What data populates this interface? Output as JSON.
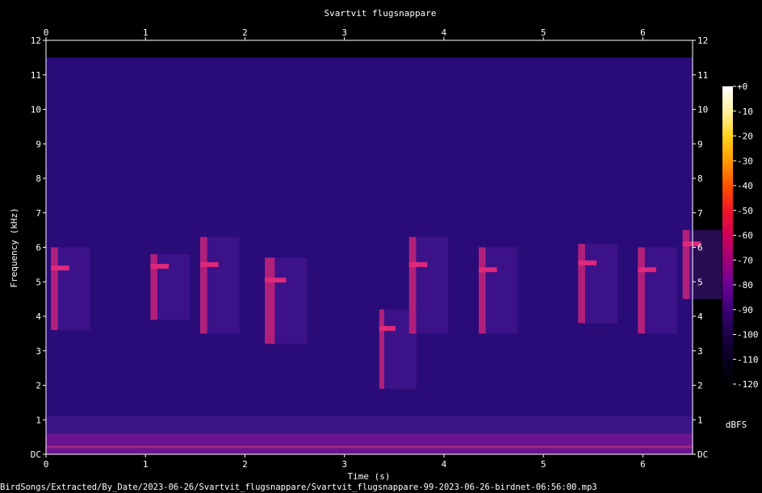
{
  "chart_data": {
    "type": "heatmap",
    "title": "Svartvit flugsnappare",
    "xlabel": "Time (s)",
    "ylabel": "Frequency (kHz)",
    "xlim": [
      0,
      6.5
    ],
    "ylim": [
      0,
      12
    ],
    "x_ticks": [
      0,
      1,
      2,
      3,
      4,
      5,
      6
    ],
    "y_ticks": [
      "DC",
      "1",
      "2",
      "3",
      "4",
      "5",
      "6",
      "7",
      "8",
      "9",
      "10",
      "11",
      "12"
    ],
    "colorbar": {
      "label": "dBFS",
      "range": [
        -120,
        0
      ],
      "ticks": [
        "+0",
        "-10",
        "-20",
        "-30",
        "-40",
        "-50",
        "-60",
        "-70",
        "-80",
        "-90",
        "-100",
        "-110",
        "-120"
      ],
      "colors": [
        "#ffffff",
        "#fff2a0",
        "#ffd21e",
        "#ff9a00",
        "#ff5200",
        "#f01428",
        "#d2005a",
        "#a00078",
        "#6a0096",
        "#3c0078",
        "#1c0048",
        "#080020",
        "#000000"
      ]
    },
    "background_level_dbfs": -100,
    "signal_upper_limit_khz": 11.5,
    "low_frequency_band_khz": [
      0,
      0.6
    ],
    "calls": [
      {
        "t_start": 0.05,
        "t_end": 0.12,
        "f_low": 3.6,
        "f_high": 6.0
      },
      {
        "t_start": 1.05,
        "t_end": 1.12,
        "f_low": 3.9,
        "f_high": 5.8
      },
      {
        "t_start": 1.55,
        "t_end": 1.62,
        "f_low": 3.5,
        "f_high": 6.3
      },
      {
        "t_start": 2.2,
        "t_end": 2.3,
        "f_low": 3.2,
        "f_high": 5.7
      },
      {
        "t_start": 3.35,
        "t_end": 3.4,
        "f_low": 1.9,
        "f_high": 4.2
      },
      {
        "t_start": 3.65,
        "t_end": 3.72,
        "f_low": 3.5,
        "f_high": 6.3
      },
      {
        "t_start": 4.35,
        "t_end": 4.42,
        "f_low": 3.5,
        "f_high": 6.0
      },
      {
        "t_start": 5.35,
        "t_end": 5.42,
        "f_low": 3.8,
        "f_high": 6.1
      },
      {
        "t_start": 5.95,
        "t_end": 6.02,
        "f_low": 3.5,
        "f_high": 6.0
      },
      {
        "t_start": 6.4,
        "t_end": 6.47,
        "f_low": 4.5,
        "f_high": 6.5
      }
    ]
  },
  "source_path": "BirdSongs/Extracted/By_Date/2023-06-26/Svartvit_flugsnappare/Svartvit_flugsnappare-99-2023-06-26-birdnet-06:56:00.mp3"
}
